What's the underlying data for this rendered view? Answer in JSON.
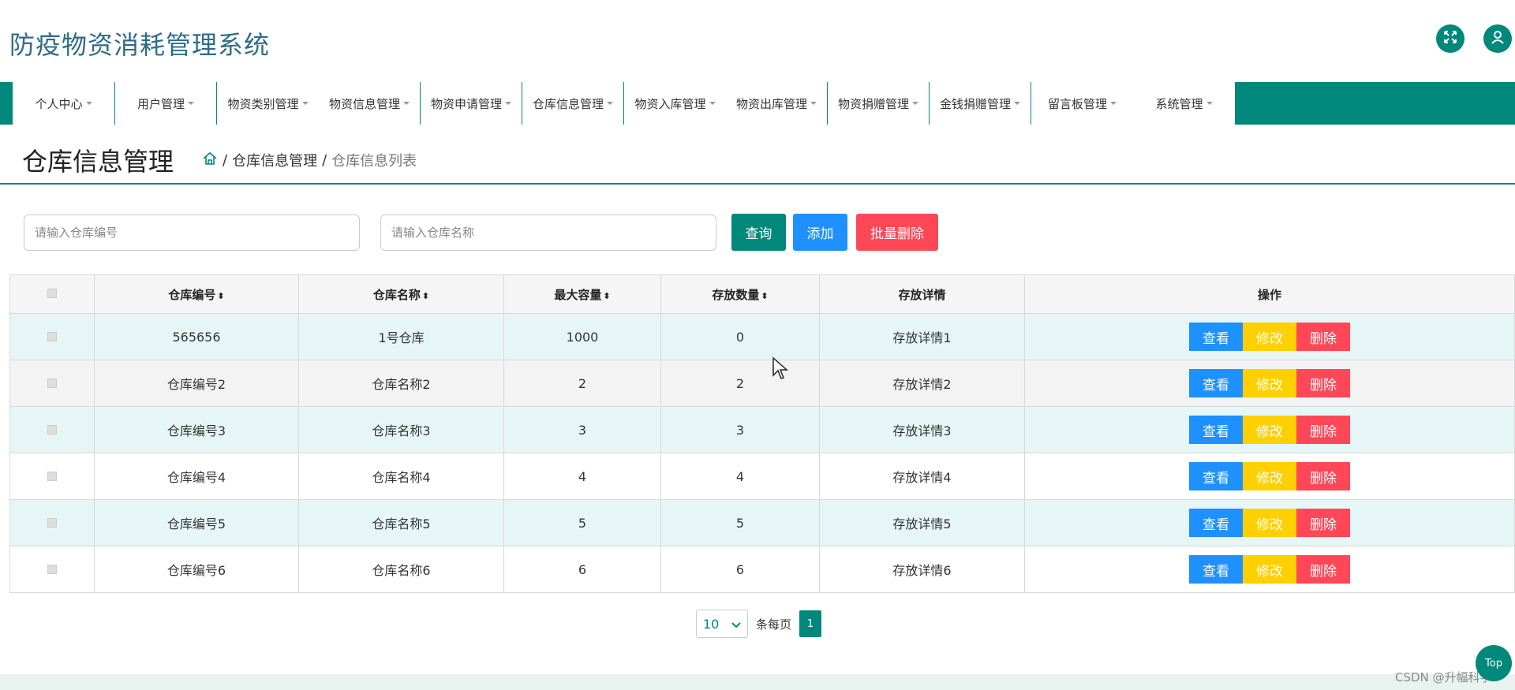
{
  "app": {
    "title": "防疫物资消耗管理系统"
  },
  "header": {
    "fullscreen_icon": "fullscreen-icon",
    "user_icon": "user-icon"
  },
  "nav": {
    "items": [
      {
        "label": "个人中心"
      },
      {
        "label": "用户管理"
      },
      {
        "label": "物资类别管理"
      },
      {
        "label": "物资信息管理"
      },
      {
        "label": "物资申请管理"
      },
      {
        "label": "仓库信息管理"
      },
      {
        "label": "物资入库管理"
      },
      {
        "label": "物资出库管理"
      },
      {
        "label": "物资捐赠管理"
      },
      {
        "label": "金钱捐赠管理"
      },
      {
        "label": "留言板管理"
      },
      {
        "label": "系统管理"
      }
    ]
  },
  "page": {
    "title": "仓库信息管理",
    "breadcrumb": {
      "home_icon": "home-icon",
      "sep": "/",
      "parent": "仓库信息管理",
      "current": "仓库信息列表"
    }
  },
  "search": {
    "code_placeholder": "请输入仓库编号",
    "name_placeholder": "请输入仓库名称",
    "query_label": "查询",
    "add_label": "添加",
    "batch_delete_label": "批量删除"
  },
  "table": {
    "headers": {
      "code": "仓库编号",
      "name": "仓库名称",
      "capacity": "最大容量",
      "stored": "存放数量",
      "detail": "存放详情",
      "ops": "操作"
    },
    "sort_glyph": "⬍",
    "rows": [
      {
        "code": "565656",
        "name": "1号仓库",
        "capacity": "1000",
        "stored": "0",
        "detail": "存放详情1"
      },
      {
        "code": "仓库编号2",
        "name": "仓库名称2",
        "capacity": "2",
        "stored": "2",
        "detail": "存放详情2"
      },
      {
        "code": "仓库编号3",
        "name": "仓库名称3",
        "capacity": "3",
        "stored": "3",
        "detail": "存放详情3"
      },
      {
        "code": "仓库编号4",
        "name": "仓库名称4",
        "capacity": "4",
        "stored": "4",
        "detail": "存放详情4"
      },
      {
        "code": "仓库编号5",
        "name": "仓库名称5",
        "capacity": "5",
        "stored": "5",
        "detail": "存放详情5"
      },
      {
        "code": "仓库编号6",
        "name": "仓库名称6",
        "capacity": "6",
        "stored": "6",
        "detail": "存放详情6"
      }
    ],
    "op_labels": {
      "view": "查看",
      "edit": "修改",
      "delete": "删除"
    }
  },
  "pagination": {
    "page_size": "10",
    "per_page_label": "条每页",
    "current_page": "1"
  },
  "floating": {
    "top_label": "Top",
    "watermark": "CSDN @升幅科学"
  },
  "colors": {
    "primary": "#00887a",
    "view": "#1e90ff",
    "edit": "#ffd000",
    "delete": "#ff4757",
    "title": "#2d6c8a"
  }
}
